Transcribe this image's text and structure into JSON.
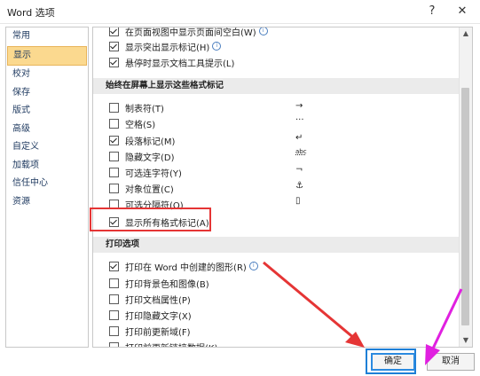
{
  "window": {
    "title": "Word 选项",
    "help_label": "?",
    "close_label": "✕"
  },
  "sidebar": {
    "items": [
      {
        "label": "常用"
      },
      {
        "label": "显示"
      },
      {
        "label": "校对"
      },
      {
        "label": "保存"
      },
      {
        "label": "版式"
      },
      {
        "label": "高级"
      },
      {
        "label": "自定义"
      },
      {
        "label": "加载项"
      },
      {
        "label": "信任中心"
      },
      {
        "label": "资源"
      }
    ],
    "active_index": 1
  },
  "top_options": [
    {
      "label": "在页面视图中显示页面间空白(W)",
      "checked": true,
      "info": true
    },
    {
      "label": "显示突出显示标记(H)",
      "checked": true,
      "info": true
    },
    {
      "label": "悬停时显示文档工具提示(L)",
      "checked": true,
      "info": false
    }
  ],
  "format_section": {
    "title": "始终在屏幕上显示这些格式标记",
    "items": [
      {
        "label": "制表符(T)",
        "checked": false,
        "symbol": "→"
      },
      {
        "label": "空格(S)",
        "checked": false,
        "symbol": "···"
      },
      {
        "label": "段落标记(M)",
        "checked": true,
        "symbol": "↵"
      },
      {
        "label": "隐藏文字(D)",
        "checked": false,
        "symbol": "abc"
      },
      {
        "label": "可选连字符(Y)",
        "checked": false,
        "symbol": "¬"
      },
      {
        "label": "对象位置(C)",
        "checked": false,
        "symbol": "⚓"
      },
      {
        "label": "可选分隔符(O)",
        "checked": false,
        "symbol": "▯"
      },
      {
        "label": "显示所有格式标记(A)",
        "checked": true,
        "symbol": ""
      }
    ]
  },
  "print_section": {
    "title": "打印选项",
    "items": [
      {
        "label": "打印在 Word 中创建的图形(R)",
        "checked": true,
        "info": true
      },
      {
        "label": "打印背景色和图像(B)",
        "checked": false,
        "info": false
      },
      {
        "label": "打印文档属性(P)",
        "checked": false,
        "info": false
      },
      {
        "label": "打印隐藏文字(X)",
        "checked": false,
        "info": false
      },
      {
        "label": "打印前更新域(F)",
        "checked": false,
        "info": false
      },
      {
        "label": "打印前更新链接数据(K)",
        "checked": false,
        "info": false
      }
    ]
  },
  "buttons": {
    "ok": "确定",
    "cancel": "取消"
  },
  "annotation_colors": {
    "red": "#e53535",
    "blue": "#1e7fd6",
    "magenta": "#e020e0"
  }
}
